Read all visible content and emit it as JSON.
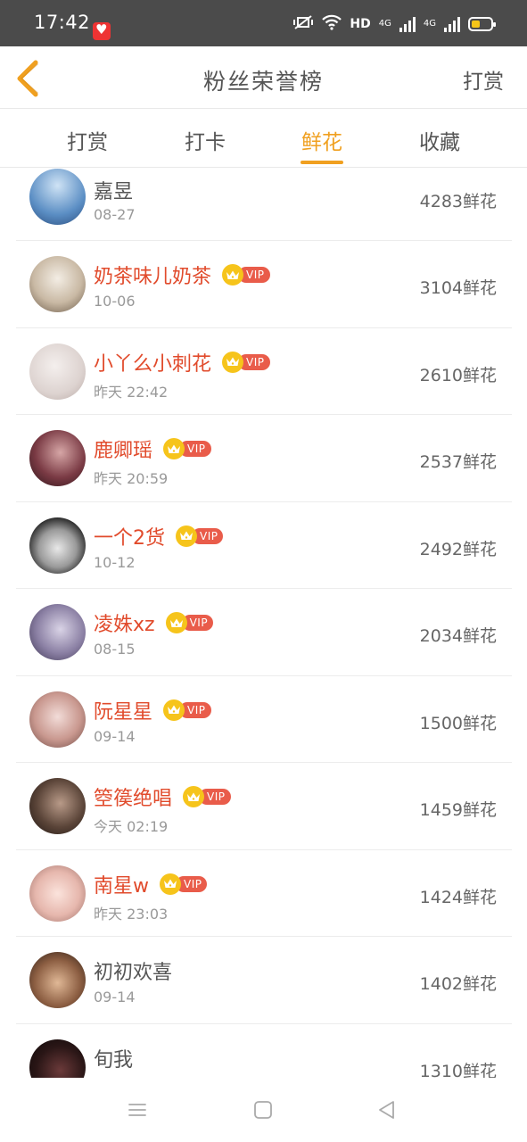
{
  "status_bar": {
    "time": "17:42",
    "network_label": "HD",
    "net_1": "4G",
    "net_2": "4G",
    "battery_color": "#f5c518"
  },
  "header": {
    "back_icon": "chevron-left-icon",
    "title": "粉丝荣誉榜",
    "action_label": "打赏"
  },
  "tabs": [
    {
      "label": "打赏",
      "active": false
    },
    {
      "label": "打卡",
      "active": false
    },
    {
      "label": "鲜花",
      "active": true
    },
    {
      "label": "收藏",
      "active": false
    }
  ],
  "accent_color": "#f0a020",
  "vip_label": "VIP",
  "fans": [
    {
      "name": "嘉昱",
      "vip": false,
      "date": "08-27",
      "count": "4283鲜花"
    },
    {
      "name": "奶茶味儿奶茶",
      "vip": true,
      "date": "10-06",
      "count": "3104鲜花"
    },
    {
      "name": "小丫么小刺花",
      "vip": true,
      "date": "昨天 22:42",
      "count": "2610鲜花"
    },
    {
      "name": "鹿卿瑶",
      "vip": true,
      "date": "昨天 20:59",
      "count": "2537鲜花"
    },
    {
      "name": "一个2货",
      "vip": true,
      "date": "10-12",
      "count": "2492鲜花"
    },
    {
      "name": "凌姝xz",
      "vip": true,
      "date": "08-15",
      "count": "2034鲜花"
    },
    {
      "name": "阮星星",
      "vip": true,
      "date": "09-14",
      "count": "1500鲜花"
    },
    {
      "name": "箜篌绝唱",
      "vip": true,
      "date": "今天 02:19",
      "count": "1459鲜花"
    },
    {
      "name": "南星w",
      "vip": true,
      "date": "昨天 23:03",
      "count": "1424鲜花"
    },
    {
      "name": "初初欢喜",
      "vip": false,
      "date": "09-14",
      "count": "1402鲜花"
    },
    {
      "name": "旬我",
      "vip": false,
      "date": "",
      "count": "1310鲜花"
    }
  ],
  "system_nav": [
    "menu-icon",
    "home-square-icon",
    "back-triangle-icon"
  ]
}
